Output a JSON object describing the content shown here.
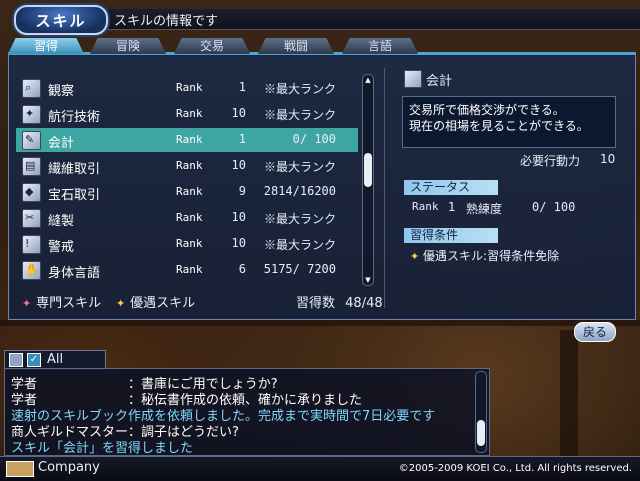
{
  "header": {
    "title": "スキル",
    "subtitle": "スキルの情報です"
  },
  "tabs": [
    {
      "label": "習得",
      "active": true
    },
    {
      "label": "冒険",
      "active": false
    },
    {
      "label": "交易",
      "active": false
    },
    {
      "label": "戦闘",
      "active": false
    },
    {
      "label": "言語",
      "active": false
    }
  ],
  "skills": [
    {
      "name": "観察",
      "rank_label": "Rank",
      "rank": "1",
      "progress": "※最大ランク",
      "icon": "magnifier-icon"
    },
    {
      "name": "航行技術",
      "rank_label": "Rank",
      "rank": "10",
      "progress": "※最大ランク",
      "icon": "compass-icon"
    },
    {
      "name": "会計",
      "rank_label": "Rank",
      "rank": "1",
      "progress": "0/ 100",
      "icon": "ledger-icon",
      "selected": true
    },
    {
      "name": "繊維取引",
      "rank_label": "Rank",
      "rank": "10",
      "progress": "※最大ランク",
      "icon": "cloth-icon"
    },
    {
      "name": "宝石取引",
      "rank_label": "Rank",
      "rank": "9",
      "progress": "2814/16200",
      "icon": "gem-icon"
    },
    {
      "name": "縫製",
      "rank_label": "Rank",
      "rank": "10",
      "progress": "※最大ランク",
      "icon": "needle-icon"
    },
    {
      "name": "警戒",
      "rank_label": "Rank",
      "rank": "10",
      "progress": "※最大ランク",
      "icon": "alert-icon"
    },
    {
      "name": "身体言語",
      "rank_label": "Rank",
      "rank": "6",
      "progress": "5175/ 7200",
      "icon": "hand-icon"
    }
  ],
  "legend": {
    "specialty": "専門スキル",
    "preferred": "優遇スキル",
    "learned_label": "習得数",
    "learned_value": "48/48"
  },
  "detail": {
    "name": "会計",
    "desc_line1": "交易所で価格交渉ができる。",
    "desc_line2": "現在の相場を見ることができる。",
    "action_label": "必要行動力",
    "action_value": "10",
    "status_header": "ステータス",
    "rank_label": "Rank",
    "rank_value": "1",
    "proficiency_label": "熟練度",
    "proficiency_value": "0/  100",
    "cond_header": "習得条件",
    "cond_text": "優遇スキル:習得条件免除"
  },
  "back_button": "戻る",
  "chat": {
    "channel": "All",
    "lines": [
      {
        "text": "学者　　　　　　　：書庫にご用でしょうか?",
        "color": "#ffffff"
      },
      {
        "text": "学者　　　　　　　：秘伝書作成の依頼、確かに承りました",
        "color": "#ffffff"
      },
      {
        "text": "速射のスキルブック作成を依頼しました。完成まで実時間で7日必要です",
        "color": "#7fd8ff"
      },
      {
        "text": "商人ギルドマスター：調子はどうだい?",
        "color": "#ffffff"
      },
      {
        "text": "スキル「会計」を習得しました",
        "color": "#7fd8ff"
      }
    ]
  },
  "footer": {
    "company": "Company",
    "copyright": "©2005-2009 KOEI Co., Ltd.  All rights reserved."
  },
  "colors": {
    "selected_row": "#3ea6a2",
    "tab_active": "#47a6d2",
    "panel": "#1c2a46"
  }
}
